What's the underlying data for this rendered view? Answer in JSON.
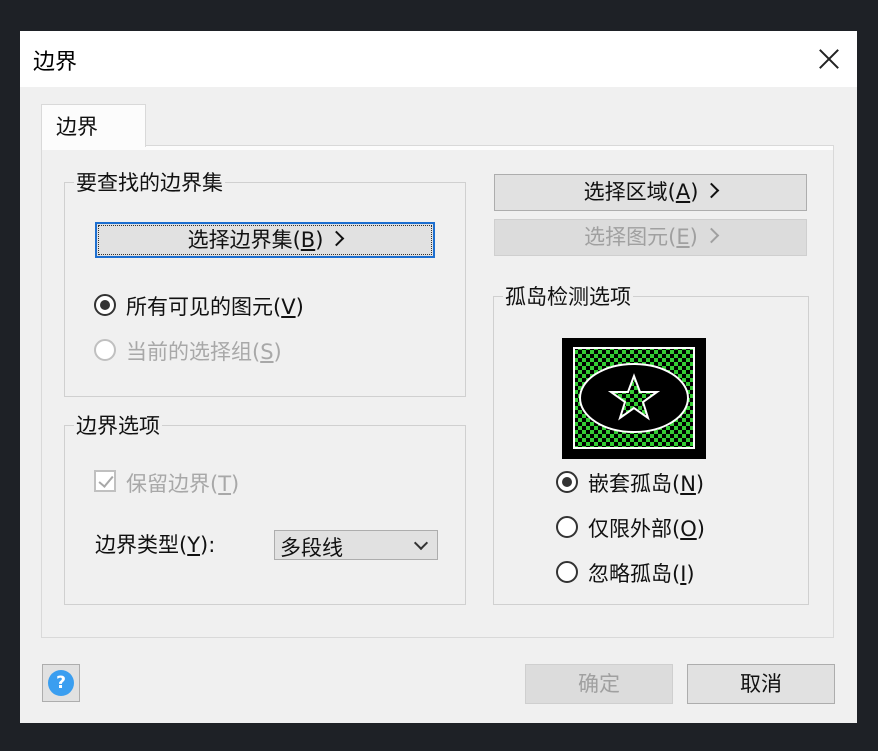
{
  "dialog": {
    "title": "边界",
    "close_icon": "close-icon"
  },
  "tabs": [
    {
      "label": "边界"
    }
  ],
  "boundary_set_group": {
    "title": "要查找的边界集",
    "select_button": "选择边界集(B)",
    "select_button_accel": "B",
    "options": [
      {
        "label_pre": "所有可见的图元(",
        "accel": "V",
        "label_post": ")",
        "checked": true,
        "enabled": true
      },
      {
        "label_pre": "当前的选择组(",
        "accel": "S",
        "label_post": ")",
        "checked": false,
        "enabled": false
      }
    ]
  },
  "boundary_options_group": {
    "title": "边界选项",
    "retain_label_pre": "保留边界(",
    "retain_accel": "T",
    "retain_label_post": ")",
    "retain_checked": true,
    "retain_enabled": false,
    "type_label_pre": "边界类型(",
    "type_accel": "Y",
    "type_label_post": "):",
    "type_value": "多段线"
  },
  "right_buttons": {
    "select_area_pre": "选择区域(",
    "select_area_accel": "A",
    "select_area_post": ")",
    "select_entity_pre": "选择图元(",
    "select_entity_accel": "E",
    "select_entity_post": ")",
    "select_entity_enabled": false
  },
  "island_group": {
    "title": "孤岛检测选项",
    "options": [
      {
        "label_pre": "嵌套孤岛(",
        "accel": "N",
        "label_post": ")",
        "checked": true
      },
      {
        "label_pre": "仅限外部(",
        "accel": "O",
        "label_post": ")",
        "checked": false
      },
      {
        "label_pre": "忽略孤岛(",
        "accel": "I",
        "label_post": ")",
        "checked": false
      }
    ],
    "preview_colors": {
      "hatch": "#33cc33",
      "background": "#000000",
      "outline": "#ffffff"
    }
  },
  "footer": {
    "help_icon": "?",
    "ok_label": "确定",
    "ok_enabled": false,
    "cancel_label": "取消"
  }
}
